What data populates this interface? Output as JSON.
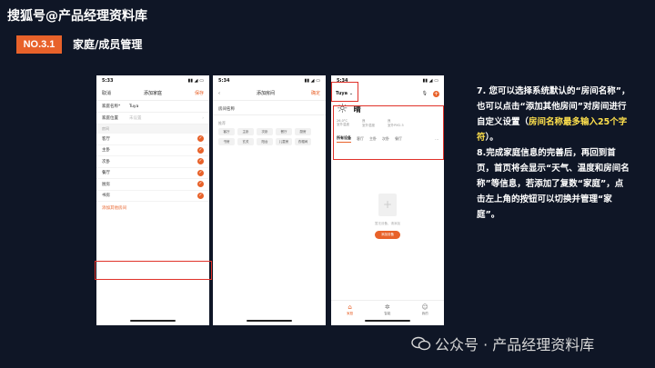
{
  "header": {
    "title": "搜狐号@产品经理资料库",
    "badge": "NO.3.1",
    "section_title": "家庭/成员管理"
  },
  "phone1": {
    "time": "5:33",
    "nav_cancel": "取消",
    "nav_title": "添加家庭",
    "nav_save": "保存",
    "home_name_label": "家庭名称*",
    "home_name_value": "Tuya",
    "home_location_label": "家庭位置",
    "home_location_value": "未设置",
    "rooms_label": "房间",
    "rooms": [
      "客厅",
      "主卧",
      "次卧",
      "餐厅",
      "厨房",
      "书房"
    ],
    "add_other": "添加其他房间"
  },
  "phone2": {
    "time": "5:34",
    "nav_title": "添加房间",
    "nav_done": "确定",
    "field_label": "房间名称",
    "rec_label": "推荐",
    "chips": [
      "客厅",
      "主卧",
      "次卧",
      "餐厅",
      "厨房",
      "书房",
      "玄关",
      "阳台",
      "儿童房",
      "衣帽间"
    ]
  },
  "phone3": {
    "time": "5:34",
    "home_name": "Tuya",
    "weather_condition": "晴",
    "stats": [
      {
        "value": "26.0°C",
        "label": "室外温度"
      },
      {
        "value": "良",
        "label": "室外湿度"
      },
      {
        "value": "良",
        "label": "室外PM2.5"
      }
    ],
    "tabs": [
      "所有设备",
      "客厅",
      "主卧",
      "次卧",
      "餐厅"
    ],
    "empty_text": "暂无设备，请添加",
    "add_device": "添加设备",
    "bottom_nav": [
      "家庭",
      "智能",
      "我的"
    ]
  },
  "description": {
    "p1_a": "7. 您可以选择系统默认的“房间名称”，也可以点击“添加其他房间”对房间进行自定义设置（",
    "p1_hl": "房间名称最多输入25个字符",
    "p1_b": "）。",
    "p2": "8.完成家庭信息的完善后，再回到首页，首页将会显示“天气、温度和房间名称”等信息，若添加了复数“家庭”，点击左上角的按钮可以切换并管理“家庭”。"
  },
  "footer": {
    "text": "公众号 · 产品经理资料库"
  },
  "colors": {
    "accent": "#e8622a",
    "highlight": "#ffe14d",
    "background": "#0f1626",
    "outline": "#e0322a"
  }
}
